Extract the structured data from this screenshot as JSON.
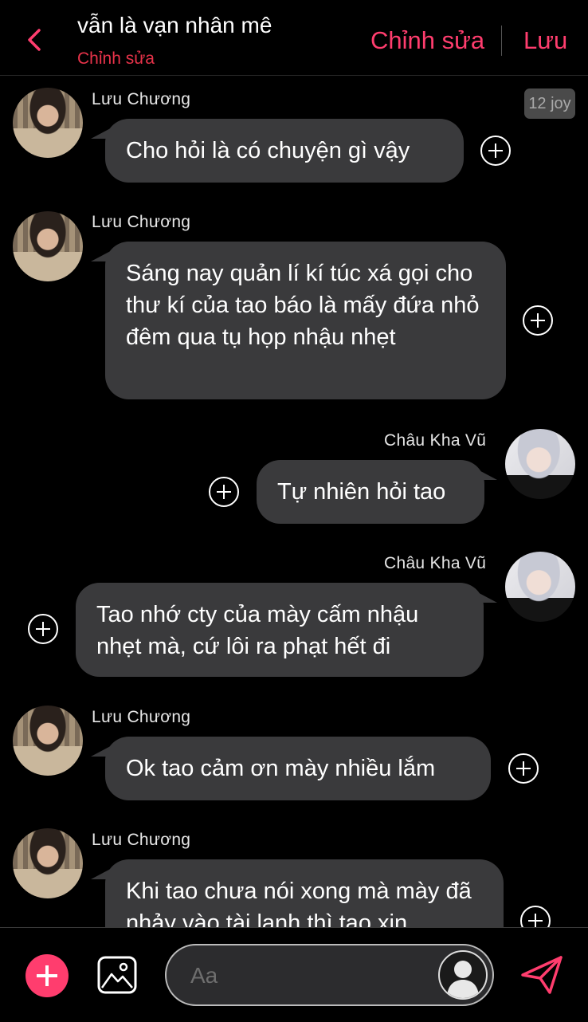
{
  "header": {
    "title": "vẫn là vạn nhân mê",
    "subtitle": "Chỉnh sửa",
    "edit_label": "Chỉnh sửa",
    "save_label": "Lưu",
    "accent_color": "#ff3d6e"
  },
  "badge": "12 joy",
  "messages": [
    {
      "sender": "Lưu Chương",
      "text": "Cho hỏi là có chuyện gì vậy",
      "side": "left"
    },
    {
      "sender": "Lưu Chương",
      "text": "Sáng nay quản lí kí túc xá gọi cho thư kí của tao báo là mấy đứa nhỏ đêm qua tụ họp nhậu nhẹt",
      "side": "left"
    },
    {
      "sender": "Châu Kha Vũ",
      "text": "Tự nhiên hỏi tao",
      "side": "right"
    },
    {
      "sender": "Châu Kha Vũ",
      "text": "Tao nhớ cty của mày cấm nhậu nhẹt mà, cứ lôi ra phạt hết đi",
      "side": "right"
    },
    {
      "sender": "Lưu Chương",
      "text": "Ok tao cảm ơn mày nhiều lắm",
      "side": "left"
    },
    {
      "sender": "Lưu Chương",
      "text": "Khi tao chưa nói xong mà mày đã nhảy vào tài lanh thì tao xin",
      "side": "left"
    }
  ],
  "composer": {
    "placeholder": "Aa",
    "icons": [
      "plus-icon",
      "image-icon",
      "profile-icon",
      "send-icon"
    ]
  }
}
